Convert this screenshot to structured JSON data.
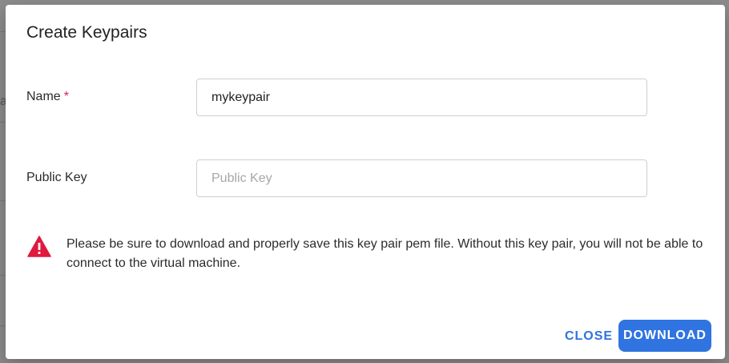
{
  "background": {
    "partial_text": "a"
  },
  "dialog": {
    "title": "Create Keypairs",
    "name_field": {
      "label": "Name",
      "required_marker": "*",
      "value": "mykeypair",
      "placeholder": ""
    },
    "public_key_field": {
      "label": "Public Key",
      "value": "",
      "placeholder": "Public Key"
    },
    "warning": {
      "icon": "warning-triangle-icon",
      "text": "Please be sure to download and properly save this key pair pem file. Without this key pair, you will not be able to connect to the virtual machine."
    },
    "actions": {
      "close_label": "CLOSE",
      "download_label": "DOWNLOAD"
    }
  },
  "colors": {
    "accent": "#2f74e0",
    "warning": "#e0193f",
    "required": "#e0195b"
  }
}
